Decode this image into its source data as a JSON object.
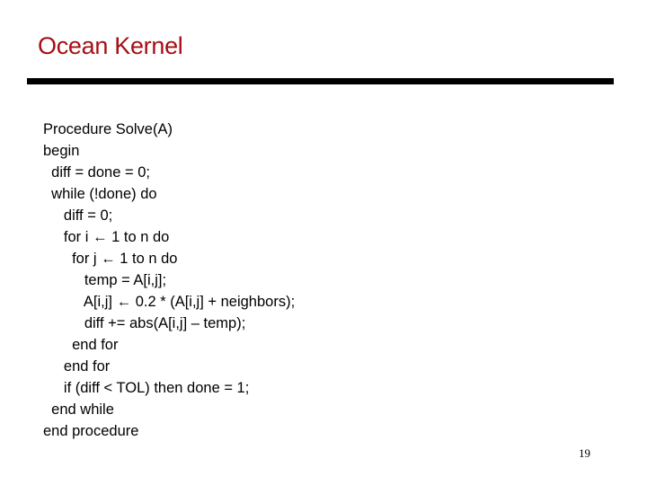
{
  "slide": {
    "title": "Ocean Kernel",
    "title_color": "#a50f15",
    "page_number": "19"
  },
  "code": {
    "lines": [
      "Procedure Solve(A)",
      "begin",
      "  diff = done = 0;",
      "  while (!done) do",
      "     diff = 0;",
      "     for i ← 1 to n do",
      "       for j ← 1 to n do",
      "          temp = A[i,j];",
      "          A[i,j] ← 0.2 * (A[i,j] + neighbors);",
      "          diff += abs(A[i,j] – temp);",
      "       end for",
      "     end for",
      "     if (diff < TOL) then done = 1;",
      "  end while",
      "end procedure"
    ]
  }
}
